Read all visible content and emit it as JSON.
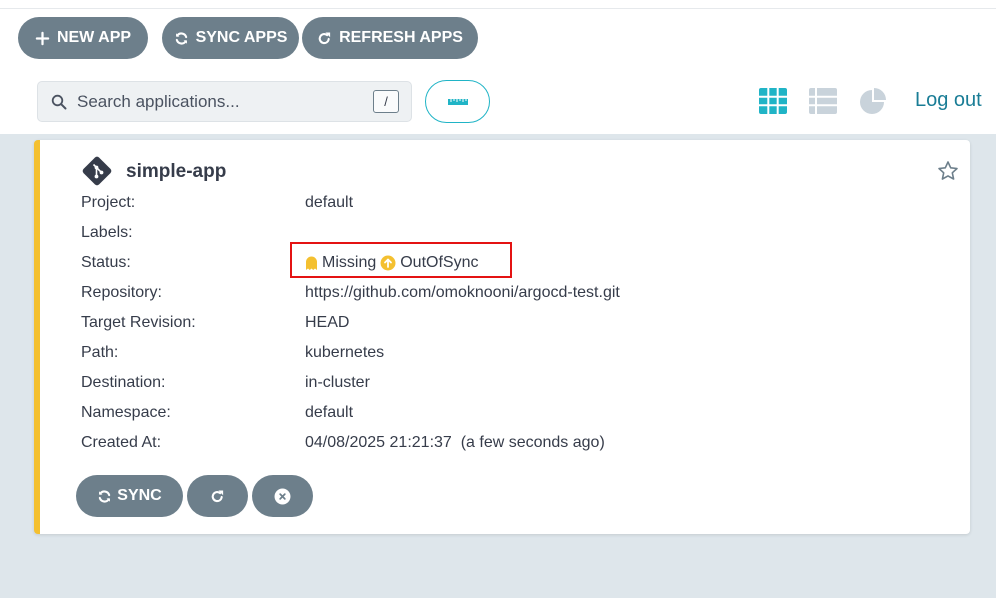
{
  "toolbar": {
    "new_app_label": "NEW APP",
    "sync_apps_label": "SYNC APPS",
    "refresh_apps_label": "REFRESH APPS"
  },
  "search": {
    "placeholder": "Search applications...",
    "shortcut": "/"
  },
  "header": {
    "logout_label": "Log out",
    "views": [
      "grid-view-icon",
      "list-view-icon",
      "pie-chart-view-icon"
    ],
    "active_view": "grid"
  },
  "app": {
    "name": "simple-app",
    "fields": {
      "project": {
        "label": "Project:",
        "value": "default"
      },
      "labels": {
        "label": "Labels:",
        "value": ""
      },
      "status": {
        "label": "Status:",
        "health": "Missing",
        "sync": "OutOfSync"
      },
      "repository": {
        "label": "Repository:",
        "value": "https://github.com/omoknooni/argocd-test.git"
      },
      "target_revision": {
        "label": "Target Revision:",
        "value": "HEAD"
      },
      "path": {
        "label": "Path:",
        "value": "kubernetes"
      },
      "destination": {
        "label": "Destination:",
        "value": "in-cluster"
      },
      "namespace": {
        "label": "Namespace:",
        "value": "default"
      },
      "created_at": {
        "label": "Created At:",
        "value": "04/08/2025 21:21:37  (a few seconds ago)"
      }
    },
    "actions": {
      "sync_label": "SYNC"
    }
  },
  "colors": {
    "accent": "#20b4c6",
    "button_gray": "#6d7f8b",
    "card_border": "#f4c030",
    "health_missing": "#f4c030",
    "sync_out_of_sync": "#f4c030",
    "highlight": "#e41313"
  }
}
